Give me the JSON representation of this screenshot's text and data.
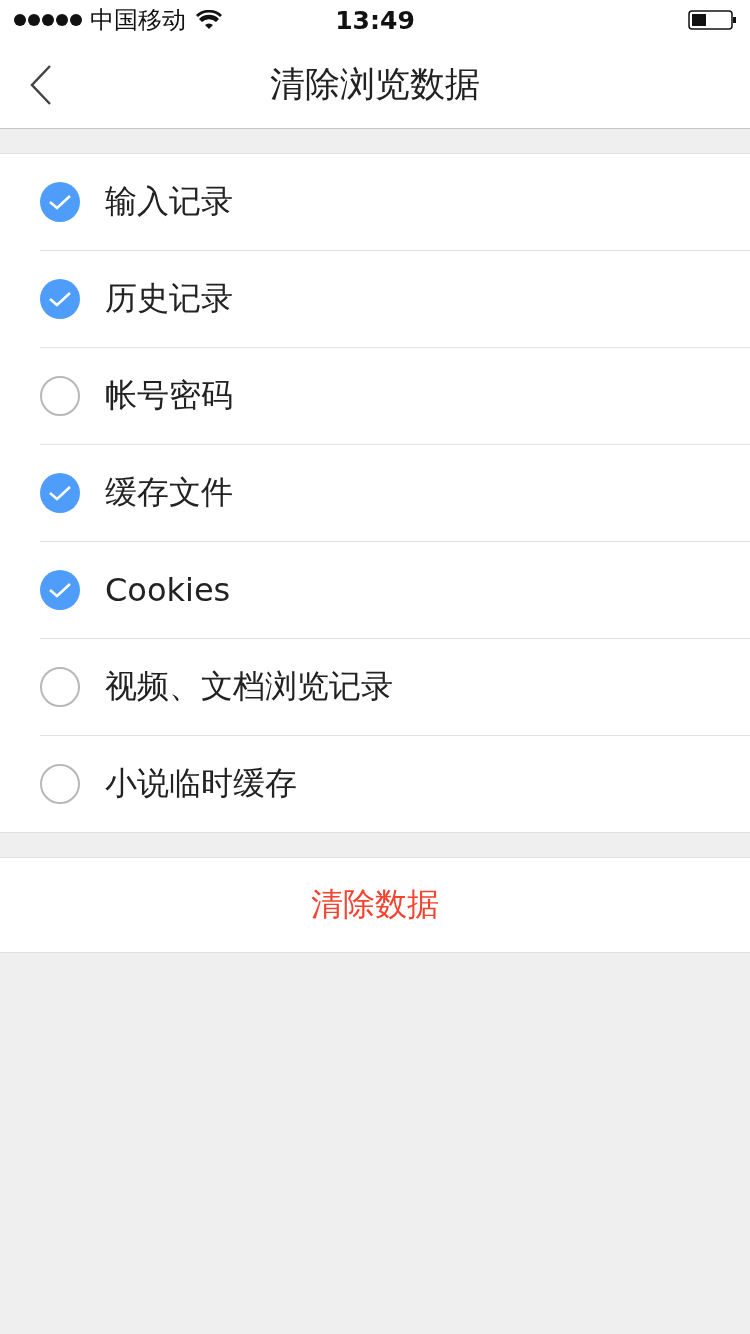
{
  "status_bar": {
    "carrier": "中国移动",
    "time": "13:49"
  },
  "nav": {
    "title": "清除浏览数据"
  },
  "options": [
    {
      "label": "输入记录",
      "checked": true
    },
    {
      "label": "历史记录",
      "checked": true
    },
    {
      "label": "帐号密码",
      "checked": false
    },
    {
      "label": "缓存文件",
      "checked": true
    },
    {
      "label": "Cookies",
      "checked": true
    },
    {
      "label": "视频、文档浏览记录",
      "checked": false
    },
    {
      "label": "小说临时缓存",
      "checked": false
    }
  ],
  "action": {
    "label": "清除数据"
  }
}
